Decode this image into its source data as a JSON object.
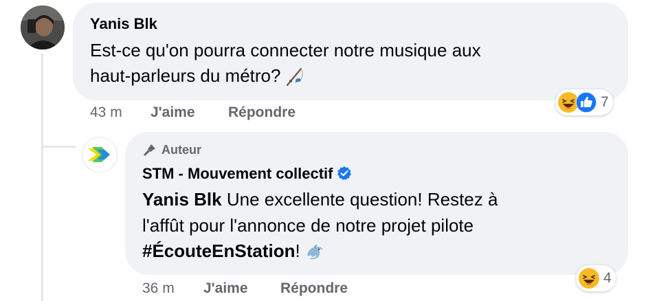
{
  "comment": {
    "author": "Yanis Blk",
    "text_line1": "Est-ce qu'on pourra connecter notre musique aux",
    "text_line2": "haut-parleurs du métro?",
    "inline_emoji": "fishing-pole-icon",
    "time": "43 m",
    "like_label": "J'aime",
    "reply_label": "Répondre",
    "reactions": [
      "laughing-face-icon",
      "thumbs-up-icon"
    ],
    "reaction_count": "7"
  },
  "reply": {
    "badge_label": "Auteur",
    "badge_icon": "microphone-icon",
    "author": "STM - Mouvement collectif",
    "verified": true,
    "mention": "Yanis Blk",
    "text_line1_rest": "Une excellente question! Restez à",
    "text_line2": "l'affût pour l'annonce de notre projet pilote",
    "hashtag": "#ÉcouteEnStation",
    "text_line3_rest": "!",
    "inline_emoji": "dolphin-icon",
    "time": "36 m",
    "like_label": "J'aime",
    "reply_label": "Répondre",
    "reactions": [
      "laughing-face-icon"
    ],
    "reaction_count": "4"
  },
  "colors": {
    "bubble": "#f0f2f5",
    "meta_text": "#65676b",
    "verified_blue": "#1877f2",
    "like_blue": "#1877f2",
    "haha_yellow": "#f7b928",
    "stm_yellow": "#f5d90a",
    "stm_green": "#44c767",
    "stm_blue": "#2a8bd8"
  }
}
